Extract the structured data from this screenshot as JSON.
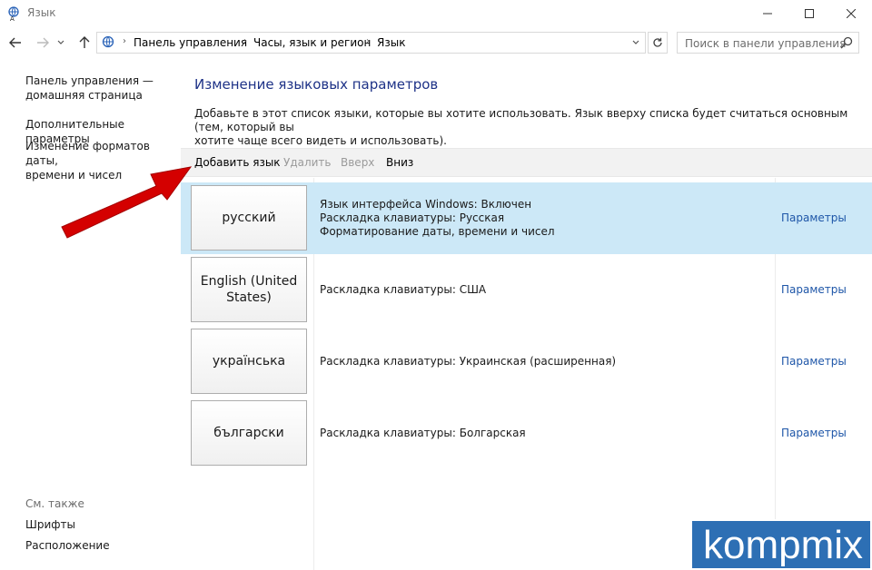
{
  "window": {
    "title": "Язык"
  },
  "address": {
    "crumbs": [
      "Панель управления",
      "Часы, язык и регион",
      "Язык"
    ],
    "search_placeholder": "Поиск в панели управления"
  },
  "left_pane": {
    "home_line1": "Панель управления —",
    "home_line2": "домашняя страница",
    "advanced": "Дополнительные параметры",
    "formats_line1": "Изменение форматов даты,",
    "formats_line2": "времени и чисел",
    "see_also": "См. также",
    "fonts": "Шрифты",
    "location": "Расположение"
  },
  "main": {
    "title": "Изменение языковых параметров",
    "description_line1": "Добавьте в этот список языки, которые вы хотите использовать. Язык вверху списка будет считаться основным (тем, который вы",
    "description_line2": "хотите чаще всего видеть и использовать)."
  },
  "toolbar": {
    "add": "Добавить язык",
    "remove": "Удалить",
    "up": "Вверх",
    "down": "Вниз"
  },
  "languages": [
    {
      "name": "русский",
      "details": [
        "Язык интерфейса Windows: Включен",
        "Раскладка клавиатуры: Русская",
        "Форматирование даты, времени и чисел"
      ],
      "options": "Параметры",
      "selected": true
    },
    {
      "name": "English (United States)",
      "details": [
        "Раскладка клавиатуры: США"
      ],
      "options": "Параметры",
      "selected": false
    },
    {
      "name": "українська",
      "details": [
        "Раскладка клавиатуры: Украинская (расширенная)"
      ],
      "options": "Параметры",
      "selected": false
    },
    {
      "name": "български",
      "details": [
        "Раскладка клавиатуры: Болгарская"
      ],
      "options": "Параметры",
      "selected": false
    }
  ],
  "watermark": {
    "text": "kompmix"
  },
  "colors": {
    "title_blue": "#1e3287",
    "link_blue": "#1e56a8",
    "selected_row": "#cce8f7",
    "arrow_red": "#d40000",
    "watermark_bg": "#2d6fb4"
  },
  "icons": [
    "language-app-icon",
    "minimize-icon",
    "maximize-icon",
    "close-icon",
    "back-arrow-icon",
    "forward-arrow-icon",
    "recent-chevron-icon",
    "up-arrow-icon",
    "control-panel-icon",
    "dropdown-chevron-icon",
    "refresh-icon",
    "search-icon",
    "annotation-arrow"
  ]
}
